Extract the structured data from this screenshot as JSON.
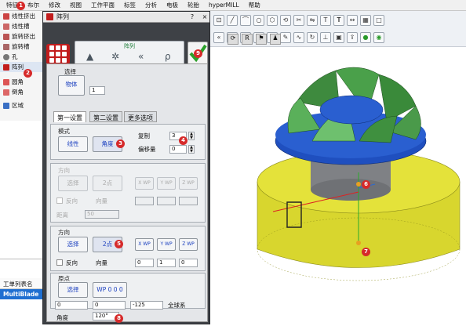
{
  "menubar": {
    "items": [
      "特征",
      "布尔",
      "修改",
      "视图",
      "工作平面",
      "标签",
      "分析",
      "电极",
      "轮胎",
      "hyperMILL",
      "帮助"
    ]
  },
  "feature_list": {
    "items": [
      {
        "label": "线性挤出",
        "icon": "extrude-icon"
      },
      {
        "label": "线性槽",
        "icon": "groove-icon"
      },
      {
        "label": "旋转挤出",
        "icon": "revolve-icon"
      },
      {
        "label": "旋转槽",
        "icon": "revolve-groove-icon"
      },
      {
        "label": "孔",
        "icon": "hole-icon"
      },
      {
        "label": "阵列",
        "icon": "pattern-icon",
        "active": true
      },
      {
        "label": "圆角",
        "icon": "fillet-icon"
      },
      {
        "label": "倒角",
        "icon": "chamfer-icon"
      },
      {
        "label": "区域",
        "icon": "region-icon"
      }
    ]
  },
  "bottom_left": {
    "header": "工单列表名",
    "selected": "MultiBlade"
  },
  "dialog": {
    "title": "阵列",
    "mode_label": "阵列",
    "sections": {
      "selection": {
        "title": "选择",
        "object_btn": "物体",
        "count": "1"
      },
      "tabs": [
        "第一设置",
        "第二设置",
        "更多选项"
      ],
      "mode": {
        "title": "模式",
        "linear_btn": "线性",
        "polar_btn": "角度",
        "copy_label": "复制",
        "copy_value": "3",
        "offset_label": "偏移量",
        "offset_value": "0"
      },
      "direction1": {
        "title": "方向",
        "select_btn": "选择",
        "btn2": "2点",
        "xwp": "X WP",
        "ywp": "Y WP",
        "zwp": "Z WP",
        "reverse": "反向",
        "vector_label": "向量",
        "distance_label": "距离",
        "distance_value": "50"
      },
      "direction2": {
        "title": "方向",
        "select_btn": "选择",
        "btn2": "2点",
        "xwp": "X WP",
        "ywp": "Y WP",
        "zwp": "Z WP",
        "reverse": "反向",
        "vector_label": "向量",
        "vec_x": "0",
        "vec_y": "1",
        "vec_z": "0"
      },
      "origin": {
        "title": "原点",
        "select_btn": "选择",
        "wp_btn": "WP 0 0 0",
        "x": "0",
        "y": "0",
        "z": "-125",
        "system_label": "全球系"
      },
      "angle": {
        "label": "角度",
        "value": "120°"
      }
    }
  },
  "badges": [
    "1",
    "2",
    "3",
    "4",
    "5",
    "6",
    "7",
    "8",
    "9"
  ],
  "colors": {
    "accent": "#c21d1d",
    "badge": "#d62a2a",
    "part_body": "#d8d62e",
    "blade": "#4a9a4a",
    "hub": "#1f4fbf"
  }
}
